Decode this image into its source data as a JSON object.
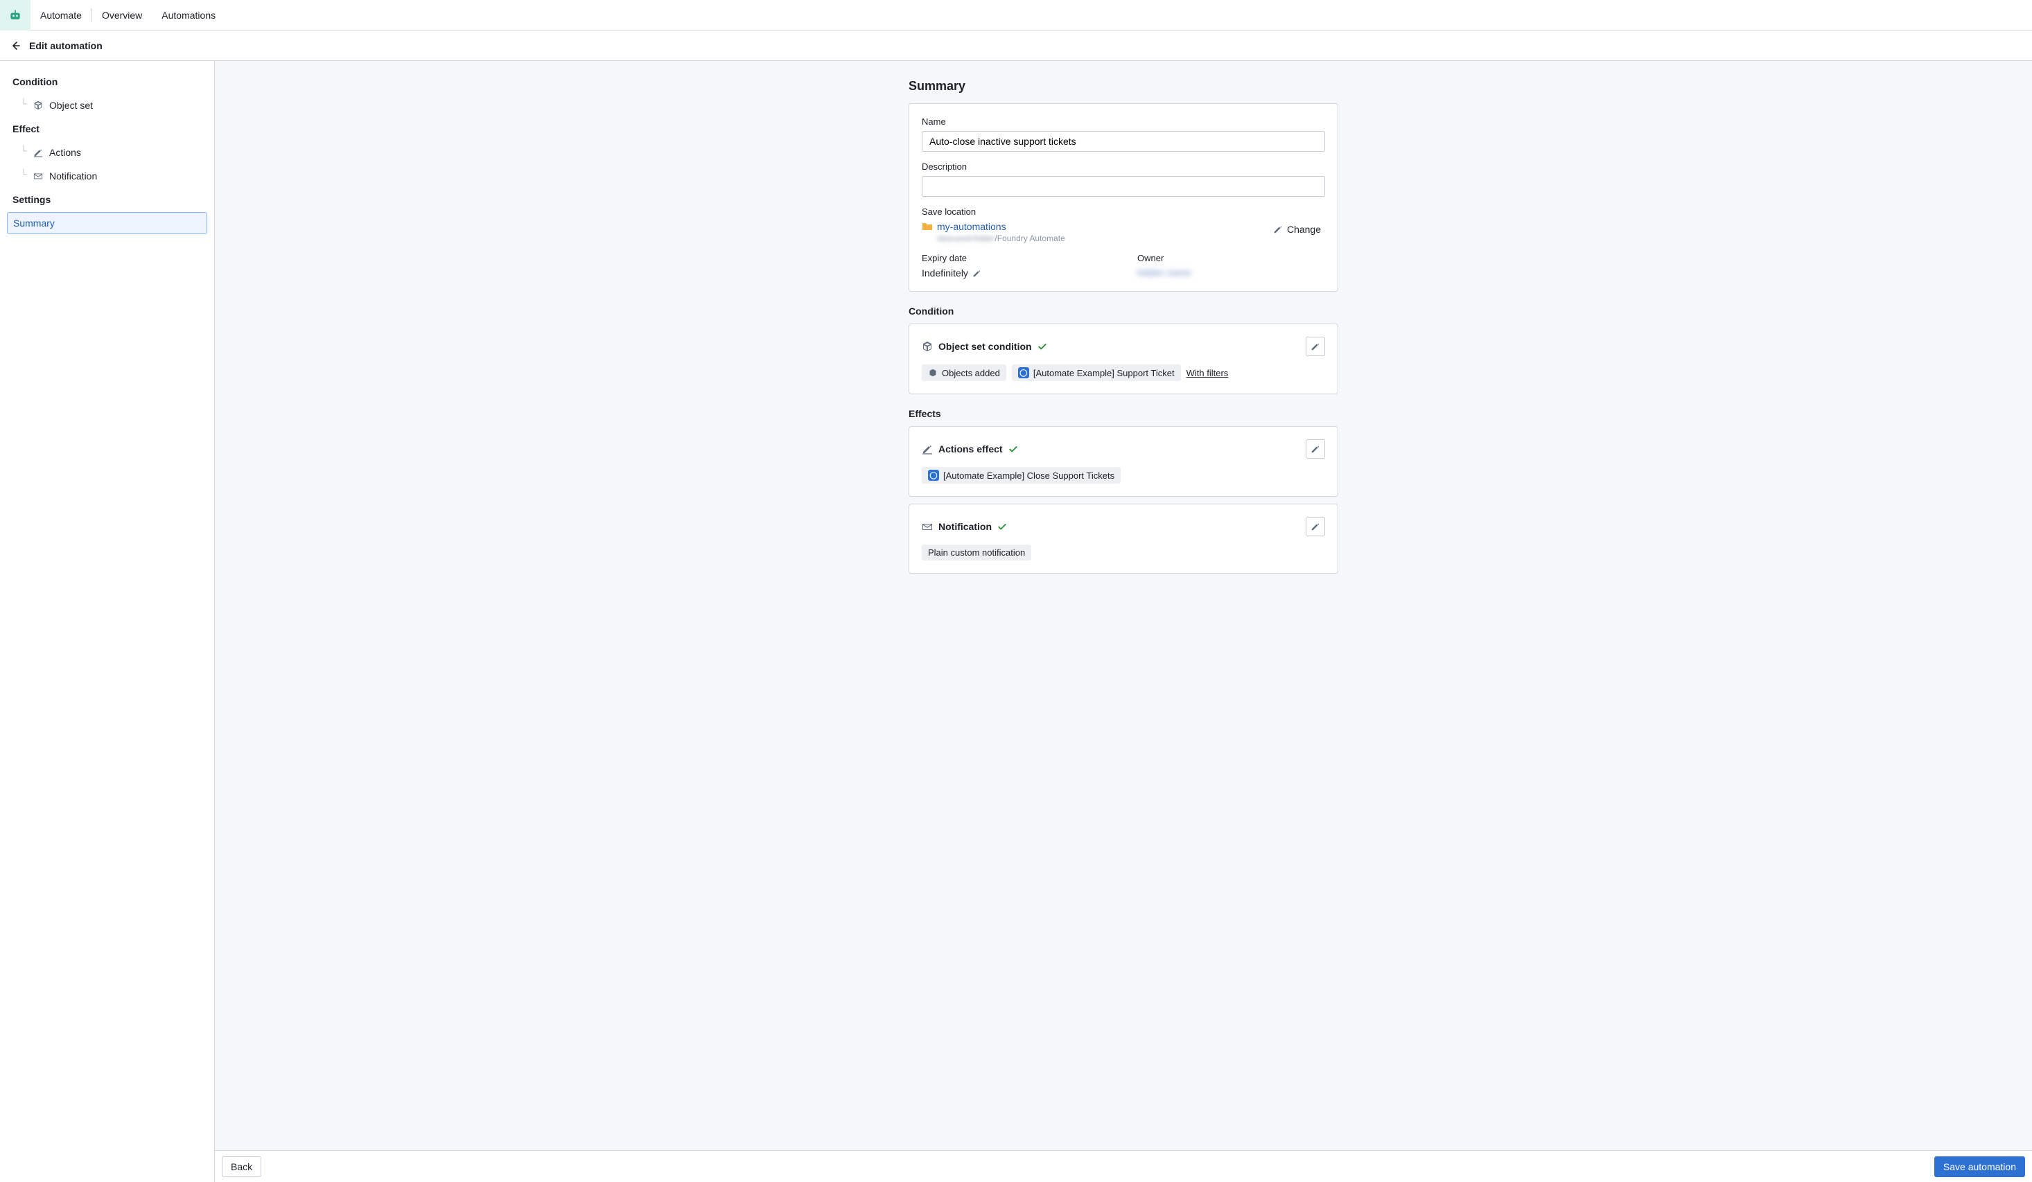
{
  "topbar": {
    "brand": "Automate",
    "nav": [
      "Overview",
      "Automations"
    ]
  },
  "subheader": {
    "title": "Edit automation"
  },
  "sidebar": {
    "sections": [
      {
        "title": "Condition",
        "items": [
          {
            "label": "Object set"
          }
        ]
      },
      {
        "title": "Effect",
        "items": [
          {
            "label": "Actions"
          },
          {
            "label": "Notification"
          }
        ]
      },
      {
        "title": "Settings",
        "items": [
          {
            "label": "Summary"
          }
        ]
      }
    ]
  },
  "main": {
    "heading": "Summary",
    "name_label": "Name",
    "name_value": "Auto-close inactive support tickets",
    "desc_label": "Description",
    "desc_value": "",
    "save_loc_label": "Save location",
    "folder": "my-automations",
    "path_hidden": "obscured-folder",
    "path_suffix": "/Foundry Automate",
    "change_label": "Change",
    "expiry_label": "Expiry date",
    "expiry_value": "Indefinitely",
    "owner_label": "Owner",
    "owner_value": "hidden owner",
    "condition_heading": "Condition",
    "condition_card": {
      "title": "Object set condition",
      "tags": {
        "objects_added": "Objects added",
        "object_type": "[Automate Example] Support Ticket",
        "with_filters": "With filters"
      }
    },
    "effects_heading": "Effects",
    "actions_card": {
      "title": "Actions effect",
      "tag": "[Automate Example] Close Support Tickets"
    },
    "notification_card": {
      "title": "Notification",
      "tag": "Plain custom notification"
    }
  },
  "footer": {
    "back": "Back",
    "save": "Save automation"
  }
}
